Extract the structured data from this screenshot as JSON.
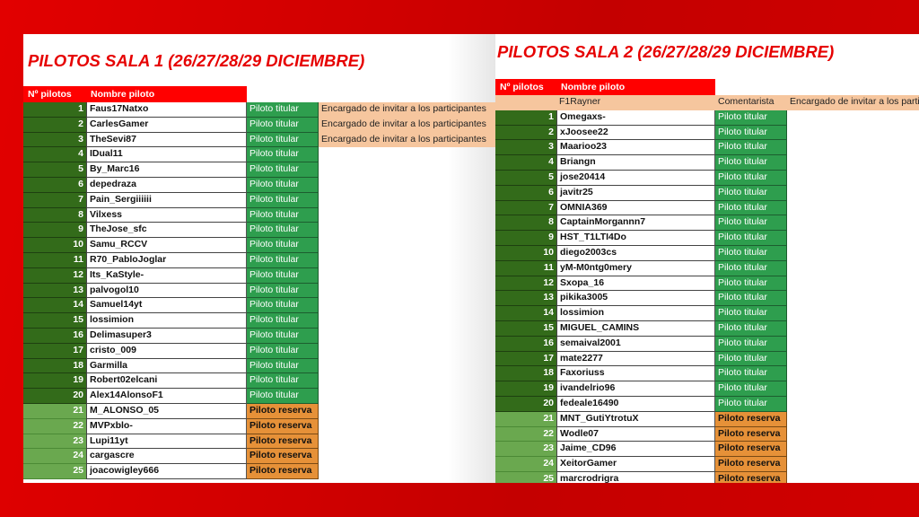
{
  "colors": {
    "background_red": "#d10000",
    "title_red": "#e60000",
    "header_red": "#ff0000",
    "num_dark_green": "#336b1a",
    "num_light_green": "#6aa84f",
    "titular_green": "#2e9e4e",
    "reserva_orange": "#e69138",
    "note_peach": "#f6c69e"
  },
  "sala1": {
    "title": "PILOTOS SALA 1 (26/27/28/29 DICIEMBRE)",
    "headers": {
      "num": "Nº pilotos",
      "name": "Nombre piloto"
    },
    "rows": [
      {
        "n": "1",
        "name": "Faus17Natxo",
        "status": "Piloto titular",
        "note": "Encargado de invitar a los participantes"
      },
      {
        "n": "2",
        "name": "CarlesGamer",
        "status": "Piloto titular",
        "note": "Encargado de invitar a los participantes"
      },
      {
        "n": "3",
        "name": "TheSevi87",
        "status": "Piloto titular",
        "note": "Encargado de invitar a los participantes"
      },
      {
        "n": "4",
        "name": "IDual11",
        "status": "Piloto titular",
        "note": ""
      },
      {
        "n": "5",
        "name": "By_Marc16",
        "status": "Piloto titular",
        "note": ""
      },
      {
        "n": "6",
        "name": "depedraza",
        "status": "Piloto titular",
        "note": ""
      },
      {
        "n": "7",
        "name": "Pain_Sergiiiiii",
        "status": "Piloto titular",
        "note": ""
      },
      {
        "n": "8",
        "name": "Vilxess",
        "status": "Piloto titular",
        "note": ""
      },
      {
        "n": "9",
        "name": "TheJose_sfc",
        "status": "Piloto titular",
        "note": ""
      },
      {
        "n": "10",
        "name": "Samu_RCCV",
        "status": "Piloto titular",
        "note": ""
      },
      {
        "n": "11",
        "name": "R70_PabloJoglar",
        "status": "Piloto titular",
        "note": ""
      },
      {
        "n": "12",
        "name": "Its_KaStyle-",
        "status": "Piloto titular",
        "note": ""
      },
      {
        "n": "13",
        "name": "palvogol10",
        "status": "Piloto titular",
        "note": ""
      },
      {
        "n": "14",
        "name": "Samuel14yt",
        "status": "Piloto titular",
        "note": ""
      },
      {
        "n": "15",
        "name": "lossimion",
        "status": "Piloto titular",
        "note": ""
      },
      {
        "n": "16",
        "name": "Delimasuper3",
        "status": "Piloto titular",
        "note": ""
      },
      {
        "n": "17",
        "name": "cristo_009",
        "status": "Piloto titular",
        "note": ""
      },
      {
        "n": "18",
        "name": "Garmilla",
        "status": "Piloto titular",
        "note": ""
      },
      {
        "n": "19",
        "name": "Robert02elcani",
        "status": "Piloto titular",
        "note": ""
      },
      {
        "n": "20",
        "name": "Alex14AlonsoF1",
        "status": "Piloto titular",
        "note": ""
      },
      {
        "n": "21",
        "name": "M_ALONSO_05",
        "status": "Piloto reserva",
        "note": ""
      },
      {
        "n": "22",
        "name": "MVPxblo-",
        "status": "Piloto reserva",
        "note": ""
      },
      {
        "n": "23",
        "name": "Lupi11yt",
        "status": "Piloto reserva",
        "note": ""
      },
      {
        "n": "24",
        "name": "cargascre",
        "status": "Piloto reserva",
        "note": ""
      },
      {
        "n": "25",
        "name": "joacowigley666",
        "status": "Piloto reserva",
        "note": ""
      }
    ]
  },
  "sala2": {
    "title": "PILOTOS SALA 2 (26/27/28/29 DICIEMBRE)",
    "headers": {
      "num": "Nº pilotos",
      "name": "Nombre piloto"
    },
    "staff_row": {
      "name": "F1Rayner",
      "role": "Comentarista",
      "note": "Encargado de invitar a los participantes"
    },
    "rows": [
      {
        "n": "1",
        "name": "Omegaxs-",
        "status": "Piloto titular"
      },
      {
        "n": "2",
        "name": "xJoosee22",
        "status": "Piloto titular"
      },
      {
        "n": "3",
        "name": "Maarioo23",
        "status": "Piloto titular"
      },
      {
        "n": "4",
        "name": "Briangn",
        "status": "Piloto titular"
      },
      {
        "n": "5",
        "name": "jose20414",
        "status": "Piloto titular"
      },
      {
        "n": "6",
        "name": "javitr25",
        "status": "Piloto titular"
      },
      {
        "n": "7",
        "name": "OMNIA369",
        "status": "Piloto titular"
      },
      {
        "n": "8",
        "name": "CaptainMorgannn7",
        "status": "Piloto titular"
      },
      {
        "n": "9",
        "name": "HST_T1LTI4Do",
        "status": "Piloto titular"
      },
      {
        "n": "10",
        "name": "diego2003cs",
        "status": "Piloto titular"
      },
      {
        "n": "11",
        "name": "yM-M0ntg0mery",
        "status": "Piloto titular"
      },
      {
        "n": "12",
        "name": "Sxopa_16",
        "status": "Piloto titular"
      },
      {
        "n": "13",
        "name": "pikika3005",
        "status": "Piloto titular"
      },
      {
        "n": "14",
        "name": "lossimion",
        "status": "Piloto titular"
      },
      {
        "n": "15",
        "name": "MIGUEL_CAMINS",
        "status": "Piloto titular"
      },
      {
        "n": "16",
        "name": "semaival2001",
        "status": "Piloto titular"
      },
      {
        "n": "17",
        "name": "mate2277",
        "status": "Piloto titular"
      },
      {
        "n": "18",
        "name": "Faxoriuss",
        "status": "Piloto titular"
      },
      {
        "n": "19",
        "name": "ivandelrio96",
        "status": "Piloto titular"
      },
      {
        "n": "20",
        "name": "fedeale16490",
        "status": "Piloto titular"
      },
      {
        "n": "21",
        "name": "MNT_GutiYtrotuX",
        "status": "Piloto reserva"
      },
      {
        "n": "22",
        "name": "Wodle07",
        "status": "Piloto reserva"
      },
      {
        "n": "23",
        "name": "Jaime_CD96",
        "status": "Piloto reserva"
      },
      {
        "n": "24",
        "name": "XeitorGamer",
        "status": "Piloto reserva"
      },
      {
        "n": "25",
        "name": "marcrodrigra",
        "status": "Piloto reserva"
      }
    ]
  }
}
